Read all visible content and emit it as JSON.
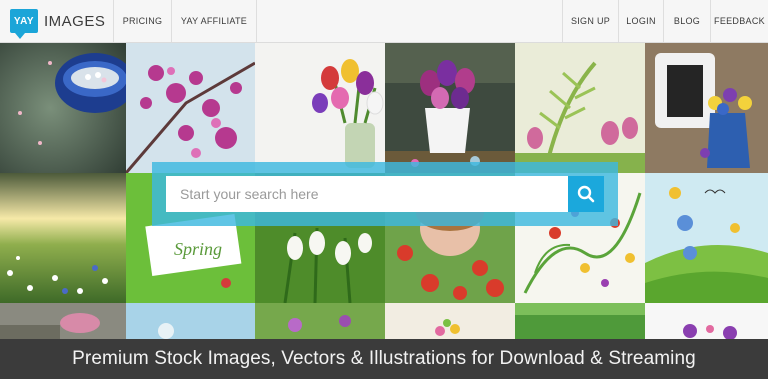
{
  "brand": {
    "badge": "YAY",
    "wordmark": "IMAGES",
    "color": "#1ba5d8"
  },
  "nav": {
    "left": [
      "PRICING",
      "YAY AFFILIATE"
    ],
    "right": [
      "SIGN UP",
      "LOGIN",
      "BLOG",
      "FEEDBACK"
    ]
  },
  "search": {
    "placeholder": "Start your search here",
    "button_icon": "search-icon",
    "panel_color": "#3db8df"
  },
  "photos": {
    "spring_card_text": "Spring"
  },
  "tagline": "Premium Stock Images, Vectors & Illustrations for Download & Streaming"
}
